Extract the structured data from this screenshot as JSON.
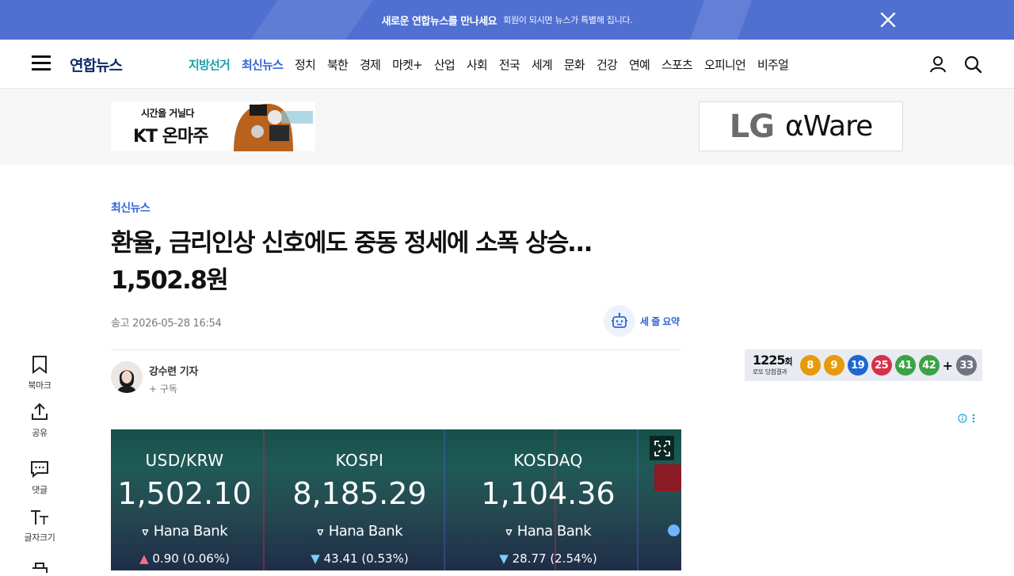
{
  "promo": {
    "strong": "새로운 연합뉴스를 만나세요",
    "sub": "회원이 되시면 뉴스가 특별해 집니다."
  },
  "header": {
    "logo": "연합뉴스",
    "nav": [
      {
        "label": "지방선거",
        "style": "teal"
      },
      {
        "label": "최신뉴스",
        "style": "blue"
      },
      {
        "label": "정치"
      },
      {
        "label": "북한"
      },
      {
        "label": "경제"
      },
      {
        "label": "마켓+"
      },
      {
        "label": "산업"
      },
      {
        "label": "사회"
      },
      {
        "label": "전국"
      },
      {
        "label": "세계"
      },
      {
        "label": "문화"
      },
      {
        "label": "건강"
      },
      {
        "label": "연예"
      },
      {
        "label": "스포츠"
      },
      {
        "label": "오피니언"
      },
      {
        "label": "비주얼"
      }
    ]
  },
  "ads": {
    "kt": {
      "line1": "시간을 거닐다",
      "line2": "KT 온마주"
    },
    "lg": {
      "brand": "LG",
      "product": "αWare"
    }
  },
  "article": {
    "category": "최신뉴스",
    "headline_line1": "환율, 금리인상 신호에도 중동 정세에 소폭 상승…",
    "headline_line2": "1,502.8원",
    "dateline": "송고 2026-05-28 16:54",
    "summary_label": "세 줄 요약",
    "author": {
      "name": "강수련 기자",
      "subscribe": "+ 구독"
    }
  },
  "photo": {
    "panels": [
      {
        "label": "USD/KRW",
        "value": "1,502.10",
        "bank": "Hana Bank",
        "direction": "up",
        "change": "0.90 (0.06%)"
      },
      {
        "label": "KOSPI",
        "value": "8,185.29",
        "bank": "Hana Bank",
        "direction": "down",
        "change": "43.41 (0.53%)"
      },
      {
        "label": "KOSDAQ",
        "value": "1,104.36",
        "bank": "Hana Bank",
        "direction": "down",
        "change": "28.77 (2.54%)"
      }
    ]
  },
  "tools": {
    "bookmark": "북마크",
    "share": "공유",
    "comment": "댓글",
    "fontsize": "글자크기"
  },
  "lotto": {
    "round": "1225",
    "round_suffix": "회",
    "caption": "로또 당첨결과",
    "balls": [
      {
        "n": "8",
        "color": "#e69a0c"
      },
      {
        "n": "9",
        "color": "#e69a0c"
      },
      {
        "n": "19",
        "color": "#1e66d0"
      },
      {
        "n": "25",
        "color": "#d9304a"
      },
      {
        "n": "41",
        "color": "#3aa344"
      },
      {
        "n": "42",
        "color": "#3aa344"
      }
    ],
    "plus": "+",
    "bonus": {
      "n": "33",
      "color": "#6f7480"
    }
  },
  "colors": {
    "accent_blue": "#3565d6",
    "teal": "#1a9fa8",
    "promo_bg": "#4f6fd1"
  }
}
